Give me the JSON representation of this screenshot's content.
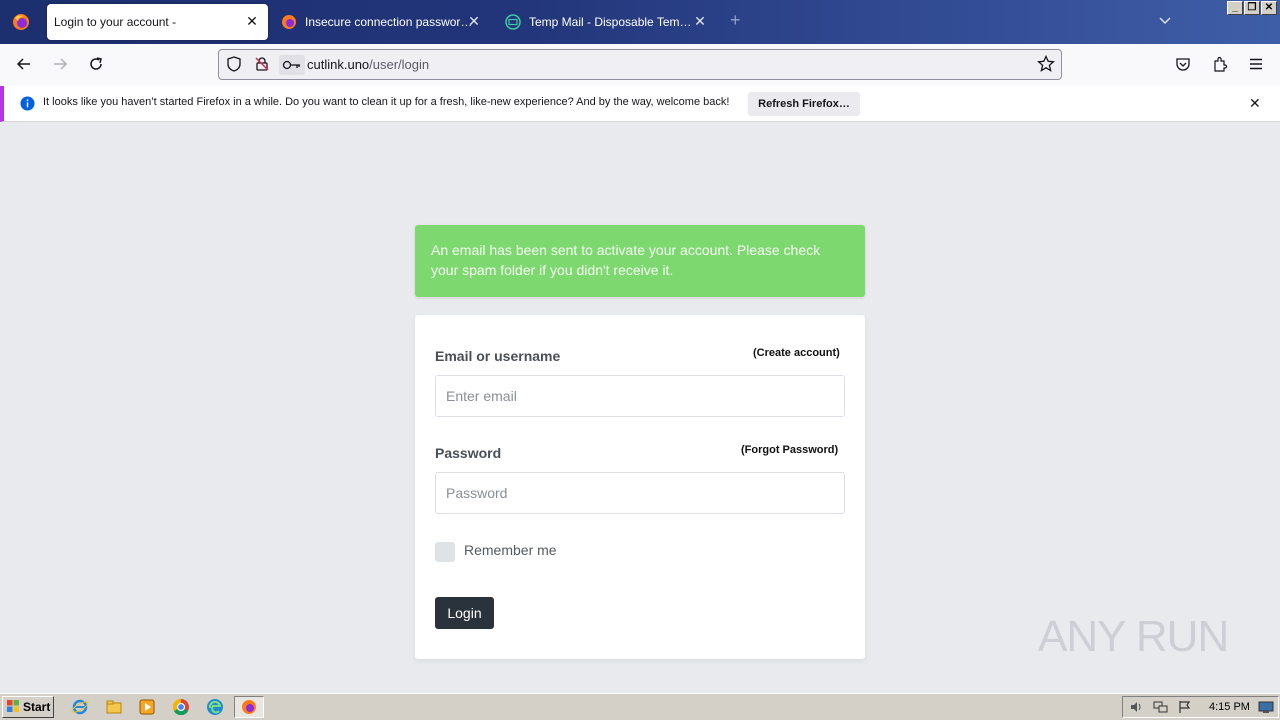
{
  "browser": {
    "tabs": [
      {
        "title": "Login to your account -",
        "active": true
      },
      {
        "title": "Insecure connection password war",
        "active": false
      },
      {
        "title": "Temp Mail - Disposable Temporary E",
        "active": false
      }
    ],
    "new_tab": "+",
    "url_host": "cutlink.uno",
    "url_path": "/user/login",
    "notification": "It looks like you haven’t started Firefox in a while. Do you want to clean it up for a fresh, like-new experience? And by the way, welcome back!",
    "refresh_button": "Refresh Firefox…"
  },
  "page": {
    "alert": "An email has been sent to activate your account. Please check your spam folder if you didn't receive it.",
    "email_label": "Email or username",
    "create_account": "(Create account)",
    "email_placeholder": "Enter email",
    "password_label": "Password",
    "forgot_password": "(Forgot Password)",
    "password_placeholder": "Password",
    "remember_me": "Remember me",
    "login_button": "Login"
  },
  "watermark": "ANY RUN",
  "taskbar": {
    "start": "Start",
    "clock": "4:15 PM"
  },
  "colors": {
    "alert_bg": "#7ed870",
    "login_btn": "#2a323c",
    "tabstrip": "#22357a",
    "notif_accent": "#b833e1"
  }
}
